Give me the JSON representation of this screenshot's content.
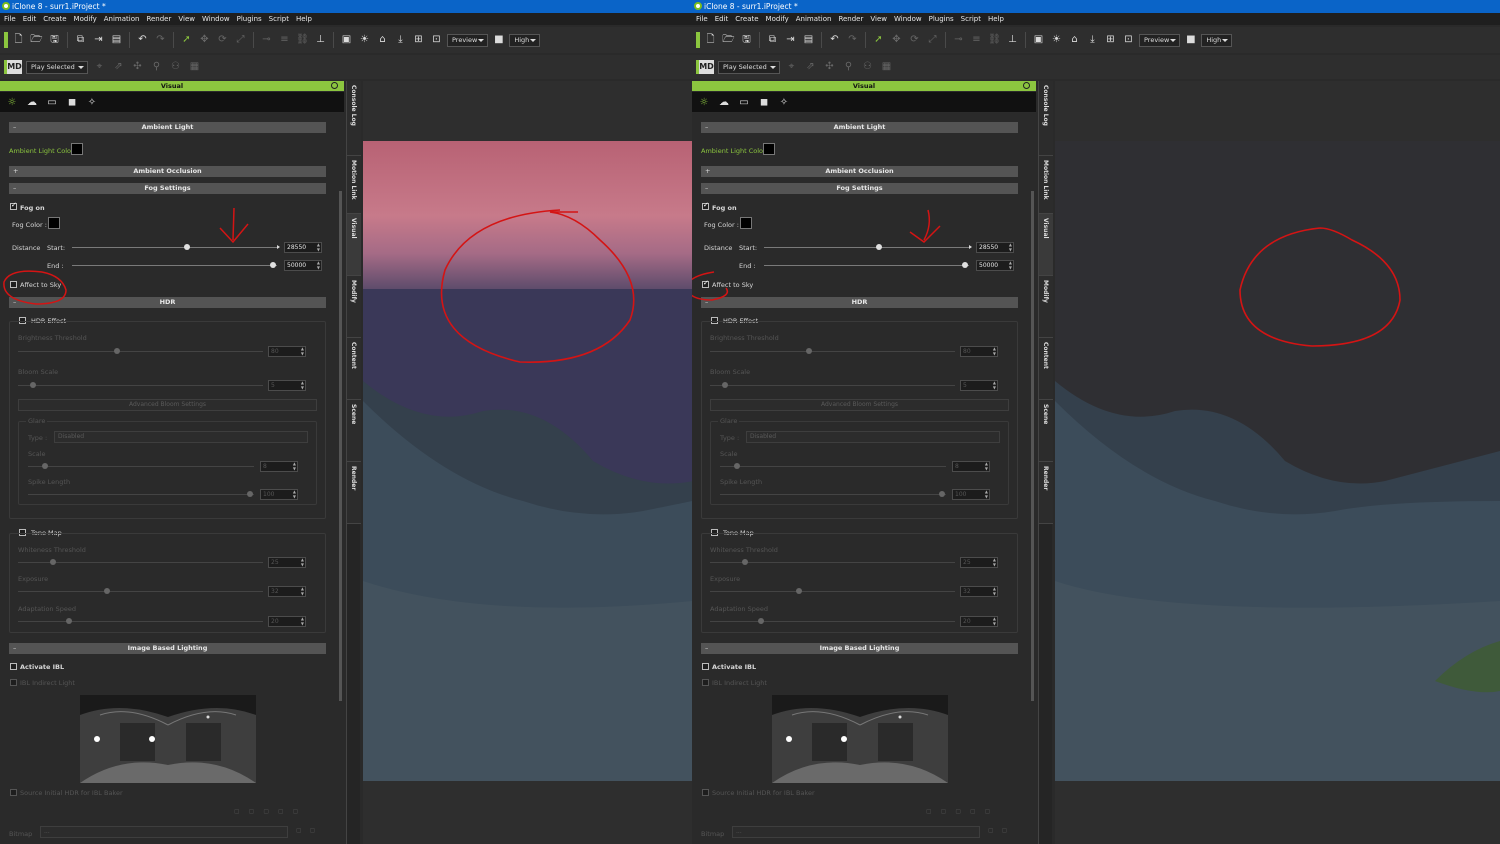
{
  "windows": [
    {
      "id": "left",
      "title": "iClone 8 - surr1.iProject *",
      "menu": [
        "File",
        "Edit",
        "Create",
        "Modify",
        "Animation",
        "Render",
        "View",
        "Window",
        "Plugins",
        "Script",
        "Help"
      ],
      "toolbar": {
        "preview_label": "Preview",
        "quality_label": "High"
      },
      "toolbar2": {
        "md_logo": "MD",
        "play_selected": "Play Selected"
      },
      "panel": {
        "title": "Visual",
        "ambient_header": "Ambient Light",
        "ambient_color_label": "Ambient Light Color :",
        "ao_header": "Ambient Occlusion",
        "fog_header": "Fog Settings",
        "fog_on_label": "Fog on",
        "fog_on_checked": true,
        "fog_color_label": "Fog Color :",
        "distance_label": "Distance",
        "start_label": "Start:",
        "start_value": "28550",
        "start_fraction": 0.56,
        "end_label": "End :",
        "end_value": "50000",
        "end_fraction": 0.98,
        "affect_sky_label": "Affect to Sky",
        "affect_sky_checked": false,
        "hdr_header": "HDR",
        "hdr_effect_label": "HDR Effect",
        "brightness_label": "Brightness Threshold",
        "brightness_value": "80",
        "bloom_label": "Bloom Scale",
        "bloom_value": "5",
        "advanced_bloom_label": "Advanced Bloom Settings",
        "glare_label": "Glare",
        "type_label": "Type :",
        "type_value": "Disabled",
        "scale_label": "Scale",
        "scale_value": "8",
        "spike_label": "Spike Length",
        "spike_value": "100",
        "tonemap_label": "Tone Map",
        "whiteness_label": "Whiteness Threshold",
        "whiteness_value": "25",
        "exposure_label": "Exposure",
        "exposure_value": "32",
        "adaptation_label": "Adaptation Speed",
        "adaptation_value": "20",
        "ibl_header": "Image Based Lighting",
        "activate_ibl_label": "Activate IBL",
        "ibl_indirect_label": "IBL Indirect Light",
        "source_hdr_label": "Source Initial HDR for IBL Baker",
        "bitmap_label": "Bitmap",
        "bitmap_value": "..."
      },
      "side_tabs": [
        "Console Log",
        "Motion Link",
        "Visual",
        "Modify",
        "Content",
        "Scene",
        "Render"
      ]
    },
    {
      "id": "right",
      "title": "iClone 8 - surr1.iProject *",
      "menu": [
        "File",
        "Edit",
        "Create",
        "Modify",
        "Animation",
        "Render",
        "View",
        "Window",
        "Plugins",
        "Script",
        "Help"
      ],
      "toolbar": {
        "preview_label": "Preview",
        "quality_label": "High"
      },
      "toolbar2": {
        "md_logo": "MD",
        "play_selected": "Play Selected"
      },
      "panel": {
        "title": "Visual",
        "ambient_header": "Ambient Light",
        "ambient_color_label": "Ambient Light Color :",
        "ao_header": "Ambient Occlusion",
        "fog_header": "Fog Settings",
        "fog_on_label": "Fog on",
        "fog_on_checked": true,
        "fog_color_label": "Fog Color :",
        "distance_label": "Distance",
        "start_label": "Start:",
        "start_value": "28550",
        "start_fraction": 0.56,
        "end_label": "End :",
        "end_value": "50000",
        "end_fraction": 0.98,
        "affect_sky_label": "Affect to Sky",
        "affect_sky_checked": true,
        "hdr_header": "HDR",
        "hdr_effect_label": "HDR Effect",
        "brightness_label": "Brightness Threshold",
        "brightness_value": "80",
        "bloom_label": "Bloom Scale",
        "bloom_value": "5",
        "advanced_bloom_label": "Advanced Bloom Settings",
        "glare_label": "Glare",
        "type_label": "Type :",
        "type_value": "Disabled",
        "scale_label": "Scale",
        "scale_value": "8",
        "spike_label": "Spike Length",
        "spike_value": "100",
        "tonemap_label": "Tone Map",
        "whiteness_label": "Whiteness Threshold",
        "whiteness_value": "25",
        "exposure_label": "Exposure",
        "exposure_value": "32",
        "adaptation_label": "Adaptation Speed",
        "adaptation_value": "20",
        "ibl_header": "Image Based Lighting",
        "activate_ibl_label": "Activate IBL",
        "ibl_indirect_label": "IBL Indirect Light",
        "source_hdr_label": "Source Initial HDR for IBL Baker",
        "bitmap_label": "Bitmap",
        "bitmap_value": "..."
      },
      "side_tabs": [
        "Console Log",
        "Motion Link",
        "Visual",
        "Modify",
        "Content",
        "Scene",
        "Render"
      ]
    }
  ],
  "colors": {
    "accent_green": "#8cc63f",
    "titlebar_blue": "#0a64c8",
    "annotation_red": "#d41414",
    "sky_pink": "#c77a8a",
    "sky_navy": "#3a3858",
    "terrain": "#3c4c5a"
  }
}
